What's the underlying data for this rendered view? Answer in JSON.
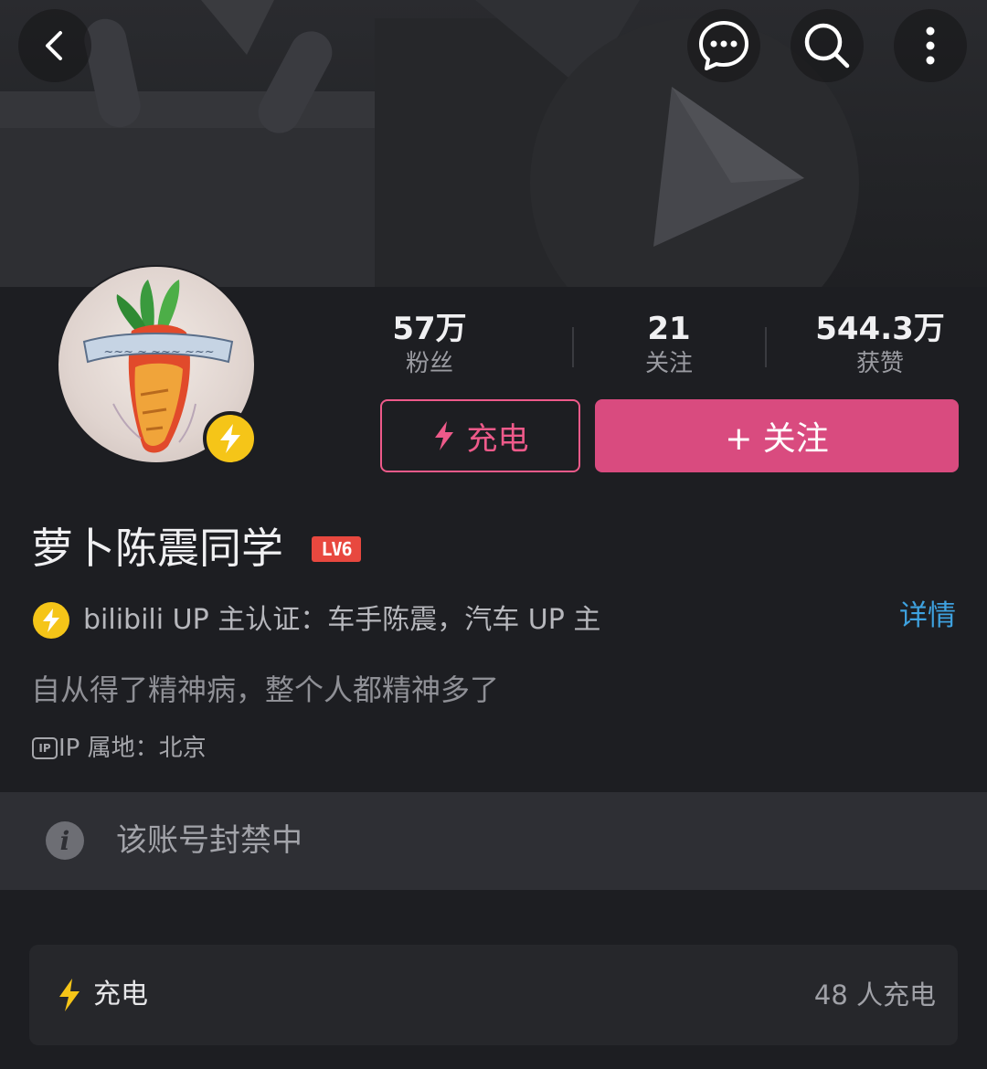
{
  "profile": {
    "username": "萝卜陈震同学",
    "level_badge": "LV6",
    "verification": "bilibili UP 主认证：车手陈震，汽车 UP 主",
    "verification_link": "详情",
    "signature": "自从得了精神病，整个人都精神多了",
    "ip_location": "IP 属地：北京",
    "ip_icon_text": "IP"
  },
  "stats": [
    {
      "value": "57万",
      "label": "粉丝"
    },
    {
      "value": "21",
      "label": "关注"
    },
    {
      "value": "544.3万",
      "label": "获赞"
    }
  ],
  "actions": {
    "charge_label": "充电",
    "follow_label": "+ 关注"
  },
  "notice": {
    "icon_text": "i",
    "text": "该账号封禁中"
  },
  "charge_card": {
    "title": "充电",
    "count": "48 人充电"
  },
  "icons": {
    "back": "chevron-left-icon",
    "message": "chat-bubble-icon",
    "search": "search-icon",
    "more": "more-vertical-icon",
    "lightning": "lightning-icon",
    "info": "info-icon"
  },
  "colors": {
    "background": "#1d1e22",
    "accent_pink": "#d94b7f",
    "charge_pink": "#ee5a8a",
    "link_blue": "#3ea2e0",
    "badge_yellow": "#f5c518",
    "level_red": "#e8483f"
  }
}
